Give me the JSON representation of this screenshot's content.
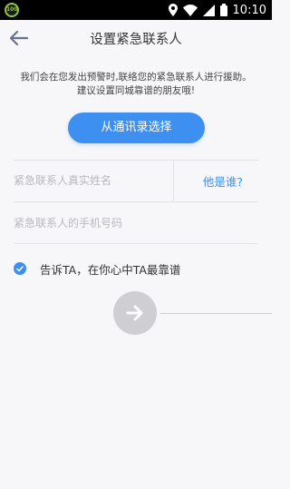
{
  "status_bar": {
    "app_icon_text": "100",
    "time": "10:10",
    "icons": [
      "location-icon",
      "wifi-icon",
      "signal-icon",
      "battery-icon"
    ]
  },
  "nav": {
    "title": "设置紧急联系人",
    "back_icon": "back-arrow-icon"
  },
  "intro": {
    "text": "我们会在您发出预警时,联络您的紧急联系人进行援助。建议设置同城靠谱的朋友哦!"
  },
  "contact_button": {
    "label": "从通讯录选择"
  },
  "form": {
    "name_placeholder": "紧急联系人真实姓名",
    "name_value": "",
    "who_link": "他是谁?",
    "phone_placeholder": "紧急联系人的手机号码",
    "phone_value": "",
    "checkbox_checked": true,
    "checkbox_label": "告诉TA，在你心中TA最靠谱"
  },
  "next_button": {
    "icon": "arrow-right-icon"
  },
  "colors": {
    "accent": "#3d8ff0",
    "background": "#f7f7f9",
    "disabled": "#cfcfd3",
    "divider": "#e2e2e6"
  }
}
